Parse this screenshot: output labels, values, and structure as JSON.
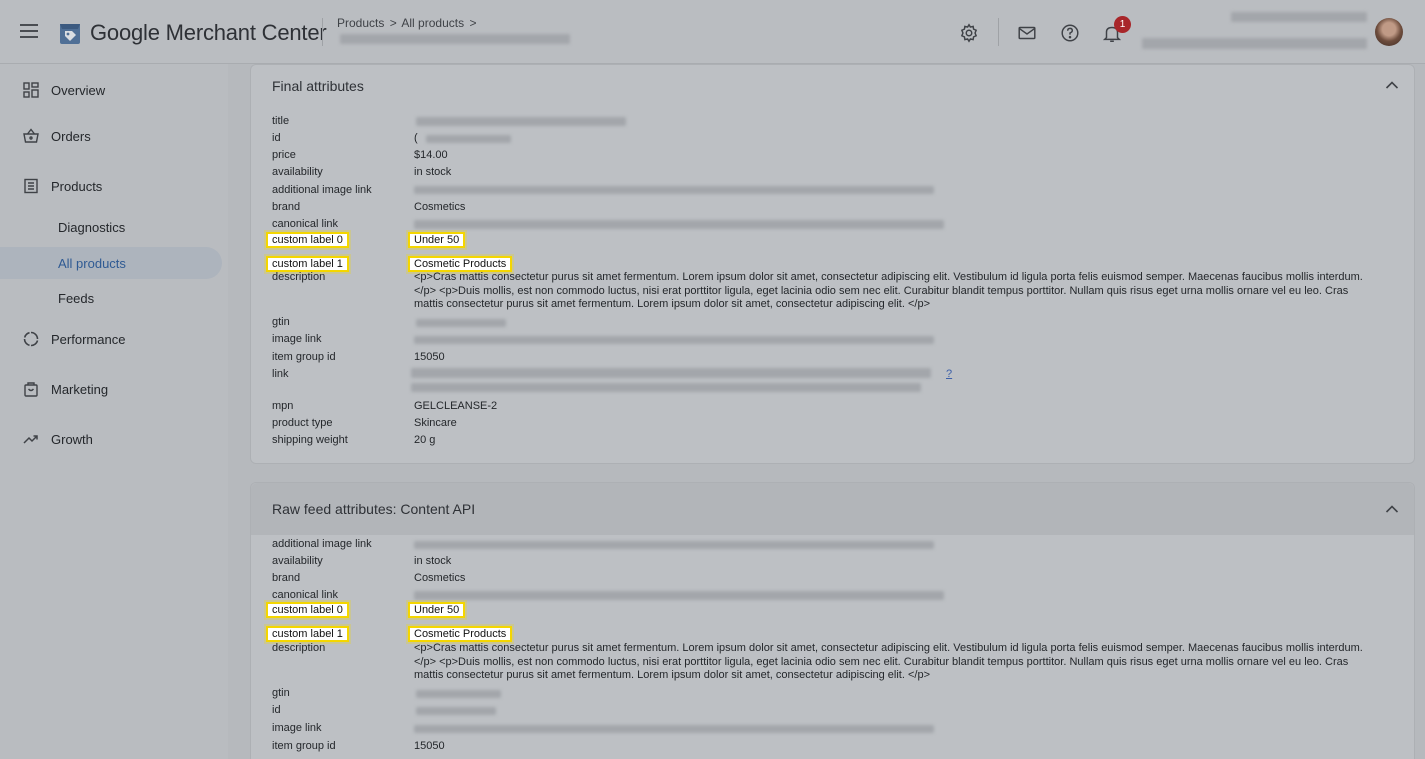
{
  "header": {
    "app_title": "Google Merchant Center",
    "breadcrumb": [
      "Products",
      "All products"
    ],
    "breadcrumb_sep": ">",
    "notification_count": "1",
    "icons": [
      "menu-icon",
      "merchant-logo-icon",
      "settings-icon",
      "mail-icon",
      "help-icon",
      "bell-icon",
      "avatar"
    ]
  },
  "sidebar": {
    "items": [
      {
        "label": "Overview",
        "icon": "overview-icon"
      },
      {
        "label": "Orders",
        "icon": "orders-basket-icon"
      },
      {
        "label": "Products",
        "icon": "products-list-icon"
      },
      {
        "label": "Diagnostics"
      },
      {
        "label": "All products",
        "active": true
      },
      {
        "label": "Feeds"
      },
      {
        "label": "Performance",
        "icon": "performance-icon"
      },
      {
        "label": "Marketing",
        "icon": "marketing-bag-icon"
      },
      {
        "label": "Growth",
        "icon": "growth-trend-icon"
      }
    ]
  },
  "final_attributes": {
    "title": "Final attributes",
    "rows": {
      "title": "title",
      "id": "id",
      "id_value_prefix": "(",
      "price": "price",
      "price_value": "$14.00",
      "availability": "availability",
      "availability_value": "in stock",
      "additional_image_link": "additional image link",
      "brand": "brand",
      "brand_value": "Cosmetics",
      "canonical_link": "canonical link",
      "custom_label_0": "custom label 0",
      "custom_label_0_value": "Under 50",
      "custom_label_1": "custom label 1",
      "custom_label_1_value": "Cosmetic Products",
      "description": "description",
      "description_value": "<p>Cras mattis consectetur purus sit amet fermentum. Lorem ipsum dolor sit amet, consectetur adipiscing elit. Vestibulum id ligula porta felis euismod semper. Maecenas faucibus mollis interdum. </p> <p>Duis mollis, est non commodo luctus, nisi erat porttitor ligula, eget lacinia odio sem nec elit. Curabitur blandit tempus porttitor. Nullam quis risus eget urna mollis ornare vel eu leo. Cras mattis consectetur purus sit amet fermentum. Lorem ipsum dolor sit amet, consectetur adipiscing elit. </p>",
      "gtin": "gtin",
      "image_link": "image link",
      "item_group_id": "item group id",
      "item_group_id_value": "15050",
      "link": "link",
      "link_value_suffix": "?",
      "mpn": "mpn",
      "mpn_value": "GELCLEANSE-2",
      "product_type": "product type",
      "product_type_value": "Skincare",
      "shipping_weight": "shipping weight",
      "shipping_weight_value": "20 g"
    }
  },
  "raw_feed_attributes": {
    "title": "Raw feed attributes: Content API",
    "rows": {
      "additional_image_link": "additional image link",
      "availability": "availability",
      "availability_value": "in stock",
      "brand": "brand",
      "brand_value": "Cosmetics",
      "canonical_link": "canonical link",
      "custom_label_0": "custom label 0",
      "custom_label_0_value": "Under 50",
      "custom_label_1": "custom label 1",
      "custom_label_1_value": "Cosmetic Products",
      "description": "description",
      "description_value": "<p>Cras mattis consectetur purus sit amet fermentum. Lorem ipsum dolor sit amet, consectetur adipiscing elit. Vestibulum id ligula porta felis euismod semper. Maecenas faucibus mollis interdum. </p> <p>Duis mollis, est non commodo luctus, nisi erat porttitor ligula, eget lacinia odio sem nec elit. Curabitur blandit tempus porttitor. Nullam quis risus eget urna mollis ornare vel eu leo. Cras mattis consectetur purus sit amet fermentum. Lorem ipsum dolor sit amet, consectetur adipiscing elit. </p>",
      "gtin": "gtin",
      "id": "id",
      "image_link": "image link",
      "item_group_id": "item group id",
      "item_group_id_value": "15050"
    }
  },
  "colors": {
    "highlight": "#f4d600",
    "active_nav_text": "#2f5a93",
    "badge": "#a8262a"
  }
}
